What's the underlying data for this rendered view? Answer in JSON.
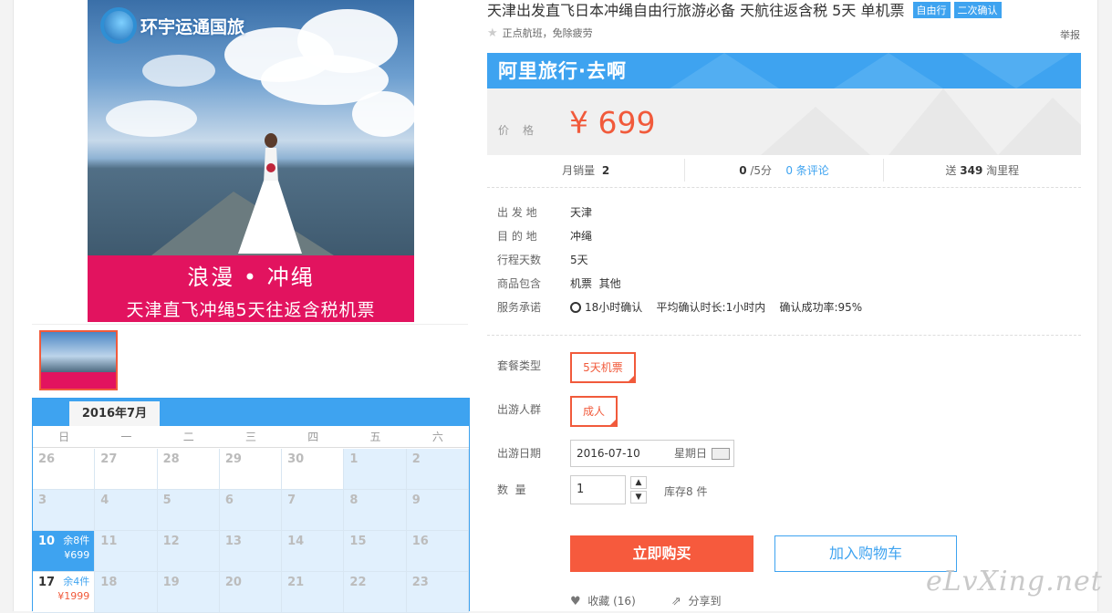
{
  "product": {
    "title": "天津出发直飞日本冲绳自由行旅游必备 天航往返含税 5天 单机票",
    "tags": [
      "自由行",
      "二次确认"
    ],
    "subtitle": "正点航班，免除疲劳",
    "report_label": "举报"
  },
  "image": {
    "logo_text": "环宇运通国旅",
    "banner_line1": "浪漫 • 冲绳",
    "banner_line2": "天津直飞冲绳5天往返含税机票"
  },
  "brand_bar": {
    "text": "阿里旅行·去啊"
  },
  "price": {
    "label": "价格",
    "value": "¥ 699"
  },
  "stats": {
    "monthly_sales_label": "月销量",
    "monthly_sales": "2",
    "rating": "0",
    "rating_suffix": "/5分",
    "reviews_link": "0 条评论",
    "points_prefix": "送",
    "points": "349",
    "points_suffix": "淘里程"
  },
  "attributes": [
    {
      "key": "出 发 地",
      "value": "天津"
    },
    {
      "key": "目 的 地",
      "value": "冲绳"
    },
    {
      "key": "行程天数",
      "value": "5天"
    },
    {
      "key": "商品包含",
      "value": "机票  其他"
    },
    {
      "key": "服务承诺",
      "value": "18小时确认    平均确认时长:1小时内    确认成功率:95%"
    }
  ],
  "options": {
    "package_label": "套餐类型",
    "package_value": "5天机票",
    "group_label": "出游人群",
    "group_value": "成人",
    "date_label": "出游日期",
    "date_value": "2016-07-10",
    "weekday": "星期日",
    "qty_label": "数  量",
    "qty_value": "1",
    "stock_text": "库存8 件"
  },
  "actions": {
    "buy_now": "立即购买",
    "add_cart": "加入购物车",
    "favorite": "收藏 (16)",
    "share": "分享到"
  },
  "calendar": {
    "month": "2016年7月",
    "weekdays": [
      "日",
      "一",
      "二",
      "三",
      "四",
      "五",
      "六"
    ],
    "row1": [
      "26",
      "27",
      "28",
      "29",
      "30",
      "1",
      "2"
    ],
    "row2": [
      "3",
      "4",
      "5",
      "6",
      "7",
      "8",
      "9"
    ],
    "row3": [
      "10",
      "11",
      "12",
      "13",
      "14",
      "15",
      "16"
    ],
    "row4": [
      "17",
      "18",
      "19",
      "20",
      "21",
      "22",
      "23"
    ],
    "d10_stock": "余8件",
    "d10_price": "¥699",
    "d17_stock": "余4件",
    "d17_price": "¥1999"
  },
  "watermark": "eLvXing.net",
  "colors": {
    "accent": "#3ea3f0",
    "price": "#f15a3b",
    "buy": "#f65a3d",
    "banner": "#e2135f"
  }
}
